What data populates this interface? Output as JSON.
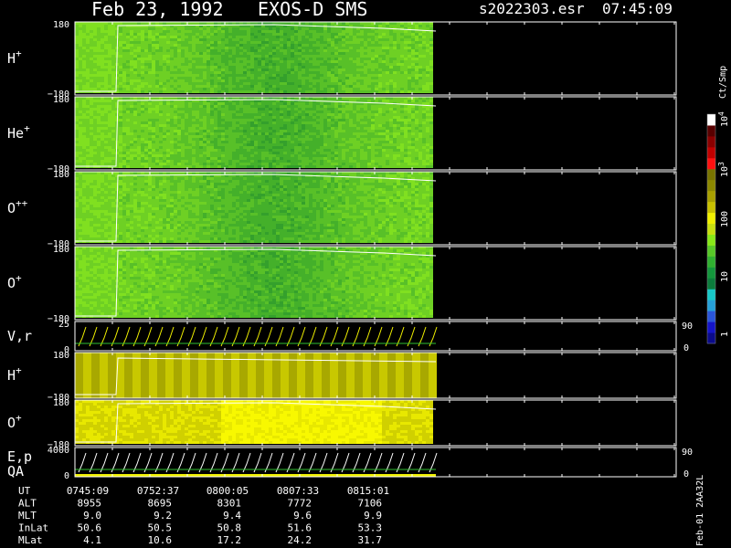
{
  "header": {
    "date": "Feb 23, 1992",
    "instrument": "EXOS-D SMS",
    "file": "s2022303.esr",
    "time": "07:45:09"
  },
  "colorbar": {
    "unit": "Ct/Smp",
    "ticks": [
      {
        "label": "1",
        "value": 1
      },
      {
        "label": "10",
        "value": 10
      },
      {
        "label": "100",
        "value": 100
      },
      {
        "label": "10^3",
        "base": "10",
        "exp": "3",
        "value": 1000
      },
      {
        "label": "10^4",
        "base": "10",
        "exp": "4",
        "value": 10000
      }
    ],
    "colors": [
      "#0b0b8a",
      "#1515c8",
      "#2a55d8",
      "#26a0d8",
      "#18c8c8",
      "#0c7c3c",
      "#14963c",
      "#30b030",
      "#58c828",
      "#88e818",
      "#c8e010",
      "#f0f000",
      "#c8c000",
      "#a8a000",
      "#8c8800",
      "#787400",
      "#ff1010",
      "#c00000",
      "#8a0000",
      "#580000",
      "#ffffff"
    ]
  },
  "panels": [
    {
      "label": "H",
      "sup": "+",
      "ymax": "180",
      "ymin": "−180",
      "type": "spectrogram"
    },
    {
      "label": "He",
      "sup": "+",
      "ymax": "180",
      "ymin": "−180",
      "type": "spectrogram"
    },
    {
      "label": "O",
      "sup": "++",
      "ymax": "180",
      "ymin": "−180",
      "type": "spectrogram"
    },
    {
      "label": "O",
      "sup": "+",
      "ymax": "180",
      "ymin": "−180",
      "type": "spectrogram"
    },
    {
      "label": "V,r",
      "sup": "",
      "ymax": "25",
      "ymin": "0",
      "rmax": "90",
      "rmin": "0",
      "type": "lines"
    },
    {
      "label": "H",
      "sup": "+",
      "ymax": "180",
      "ymin": "−180",
      "type": "stripes"
    },
    {
      "label": "O",
      "sup": "+",
      "ymax": "180",
      "ymin": "−180",
      "type": "yellow"
    },
    {
      "label": "E,p",
      "label2": "QA",
      "sup": "",
      "ymax": "4000",
      "ymin": "0",
      "rmax": "90",
      "rmin": "0",
      "type": "lines2"
    }
  ],
  "side_label": "Feb-01 2AA32L",
  "table": {
    "rows": [
      {
        "name": "UT",
        "values": [
          "0745:09",
          "0752:37",
          "0800:05",
          "0807:33",
          "0815:01"
        ]
      },
      {
        "name": "ALT",
        "values": [
          "8955",
          "8695",
          "8301",
          "7772",
          "7106"
        ]
      },
      {
        "name": "MLT",
        "values": [
          "9.0",
          "9.2",
          "9.4",
          "9.6",
          "9.9"
        ]
      },
      {
        "name": "InLat",
        "values": [
          "50.6",
          "50.5",
          "50.8",
          "51.6",
          "53.3"
        ]
      },
      {
        "name": "MLat",
        "values": [
          "4.1",
          "10.6",
          "17.2",
          "24.2",
          "31.7"
        ]
      }
    ]
  }
}
